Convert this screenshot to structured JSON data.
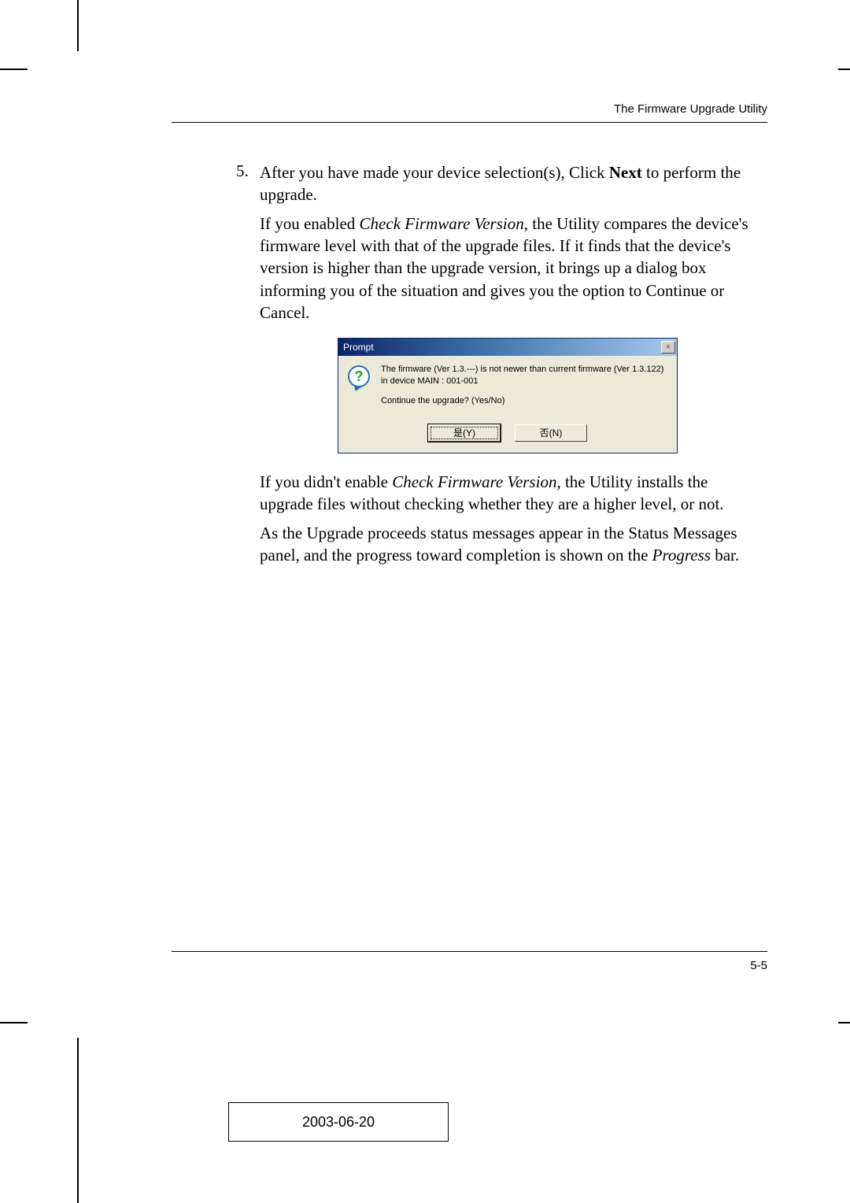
{
  "header": {
    "section_title": "The Firmware Upgrade Utility"
  },
  "step": {
    "number": "5.",
    "para1_before_bold": "After you have made your device selection(s), Click ",
    "para1_bold": "Next",
    "para1_after_bold": " to perform the upgrade.",
    "para2_before_italic": "If you enabled ",
    "para2_italic": "Check Firmware Version",
    "para2_after_italic": ", the Utility compares the device's firmware level with that of the upgrade files. If it finds that the device's version is higher than the upgrade version, it brings up a dialog box informing you of the situation and gives you the option to Continue or Cancel.",
    "para3_before_italic": "If you didn't enable ",
    "para3_italic": "Check Firmware Version",
    "para3_after_italic": ", the Utility installs the upgrade files without checking whether they are a higher level, or not.",
    "para4_before_italic": "As the Upgrade proceeds status messages appear in the Status Messages panel, and the progress toward completion is shown on the ",
    "para4_italic": "Progress",
    "para4_after_italic": " bar."
  },
  "dialog": {
    "title": "Prompt",
    "close_glyph": "×",
    "question_glyph": "?",
    "message_line1": "The firmware (Ver 1.3.---) is not newer than current firmware (Ver 1.3.122) in device MAIN : 001-001",
    "message_line2": "Continue the upgrade? (Yes/No)",
    "yes_label": "是(Y)",
    "no_label": "否(N)"
  },
  "footer": {
    "page_number": "5-5",
    "date": "2003-06-20"
  }
}
